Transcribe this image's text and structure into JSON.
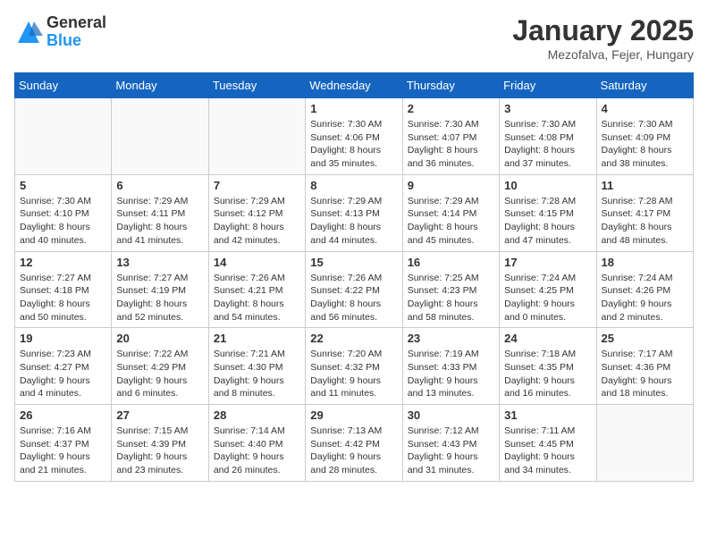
{
  "header": {
    "logo_general": "General",
    "logo_blue": "Blue",
    "month_title": "January 2025",
    "location": "Mezofalva, Fejer, Hungary"
  },
  "weekdays": [
    "Sunday",
    "Monday",
    "Tuesday",
    "Wednesday",
    "Thursday",
    "Friday",
    "Saturday"
  ],
  "weeks": [
    [
      {
        "day": "",
        "info": ""
      },
      {
        "day": "",
        "info": ""
      },
      {
        "day": "",
        "info": ""
      },
      {
        "day": "1",
        "info": "Sunrise: 7:30 AM\nSunset: 4:06 PM\nDaylight: 8 hours and 35 minutes."
      },
      {
        "day": "2",
        "info": "Sunrise: 7:30 AM\nSunset: 4:07 PM\nDaylight: 8 hours and 36 minutes."
      },
      {
        "day": "3",
        "info": "Sunrise: 7:30 AM\nSunset: 4:08 PM\nDaylight: 8 hours and 37 minutes."
      },
      {
        "day": "4",
        "info": "Sunrise: 7:30 AM\nSunset: 4:09 PM\nDaylight: 8 hours and 38 minutes."
      }
    ],
    [
      {
        "day": "5",
        "info": "Sunrise: 7:30 AM\nSunset: 4:10 PM\nDaylight: 8 hours and 40 minutes."
      },
      {
        "day": "6",
        "info": "Sunrise: 7:29 AM\nSunset: 4:11 PM\nDaylight: 8 hours and 41 minutes."
      },
      {
        "day": "7",
        "info": "Sunrise: 7:29 AM\nSunset: 4:12 PM\nDaylight: 8 hours and 42 minutes."
      },
      {
        "day": "8",
        "info": "Sunrise: 7:29 AM\nSunset: 4:13 PM\nDaylight: 8 hours and 44 minutes."
      },
      {
        "day": "9",
        "info": "Sunrise: 7:29 AM\nSunset: 4:14 PM\nDaylight: 8 hours and 45 minutes."
      },
      {
        "day": "10",
        "info": "Sunrise: 7:28 AM\nSunset: 4:15 PM\nDaylight: 8 hours and 47 minutes."
      },
      {
        "day": "11",
        "info": "Sunrise: 7:28 AM\nSunset: 4:17 PM\nDaylight: 8 hours and 48 minutes."
      }
    ],
    [
      {
        "day": "12",
        "info": "Sunrise: 7:27 AM\nSunset: 4:18 PM\nDaylight: 8 hours and 50 minutes."
      },
      {
        "day": "13",
        "info": "Sunrise: 7:27 AM\nSunset: 4:19 PM\nDaylight: 8 hours and 52 minutes."
      },
      {
        "day": "14",
        "info": "Sunrise: 7:26 AM\nSunset: 4:21 PM\nDaylight: 8 hours and 54 minutes."
      },
      {
        "day": "15",
        "info": "Sunrise: 7:26 AM\nSunset: 4:22 PM\nDaylight: 8 hours and 56 minutes."
      },
      {
        "day": "16",
        "info": "Sunrise: 7:25 AM\nSunset: 4:23 PM\nDaylight: 8 hours and 58 minutes."
      },
      {
        "day": "17",
        "info": "Sunrise: 7:24 AM\nSunset: 4:25 PM\nDaylight: 9 hours and 0 minutes."
      },
      {
        "day": "18",
        "info": "Sunrise: 7:24 AM\nSunset: 4:26 PM\nDaylight: 9 hours and 2 minutes."
      }
    ],
    [
      {
        "day": "19",
        "info": "Sunrise: 7:23 AM\nSunset: 4:27 PM\nDaylight: 9 hours and 4 minutes."
      },
      {
        "day": "20",
        "info": "Sunrise: 7:22 AM\nSunset: 4:29 PM\nDaylight: 9 hours and 6 minutes."
      },
      {
        "day": "21",
        "info": "Sunrise: 7:21 AM\nSunset: 4:30 PM\nDaylight: 9 hours and 8 minutes."
      },
      {
        "day": "22",
        "info": "Sunrise: 7:20 AM\nSunset: 4:32 PM\nDaylight: 9 hours and 11 minutes."
      },
      {
        "day": "23",
        "info": "Sunrise: 7:19 AM\nSunset: 4:33 PM\nDaylight: 9 hours and 13 minutes."
      },
      {
        "day": "24",
        "info": "Sunrise: 7:18 AM\nSunset: 4:35 PM\nDaylight: 9 hours and 16 minutes."
      },
      {
        "day": "25",
        "info": "Sunrise: 7:17 AM\nSunset: 4:36 PM\nDaylight: 9 hours and 18 minutes."
      }
    ],
    [
      {
        "day": "26",
        "info": "Sunrise: 7:16 AM\nSunset: 4:37 PM\nDaylight: 9 hours and 21 minutes."
      },
      {
        "day": "27",
        "info": "Sunrise: 7:15 AM\nSunset: 4:39 PM\nDaylight: 9 hours and 23 minutes."
      },
      {
        "day": "28",
        "info": "Sunrise: 7:14 AM\nSunset: 4:40 PM\nDaylight: 9 hours and 26 minutes."
      },
      {
        "day": "29",
        "info": "Sunrise: 7:13 AM\nSunset: 4:42 PM\nDaylight: 9 hours and 28 minutes."
      },
      {
        "day": "30",
        "info": "Sunrise: 7:12 AM\nSunset: 4:43 PM\nDaylight: 9 hours and 31 minutes."
      },
      {
        "day": "31",
        "info": "Sunrise: 7:11 AM\nSunset: 4:45 PM\nDaylight: 9 hours and 34 minutes."
      },
      {
        "day": "",
        "info": ""
      }
    ]
  ]
}
